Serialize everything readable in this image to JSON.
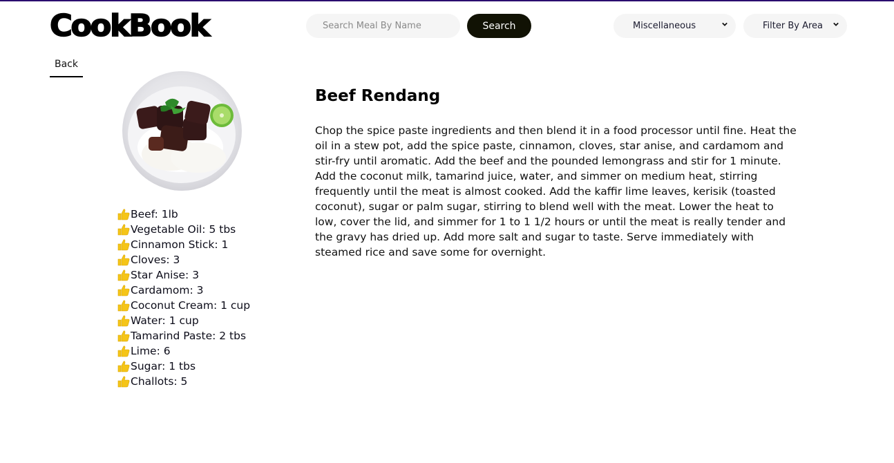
{
  "header": {
    "logo": "CookBook",
    "search": {
      "placeholder": "Search Meal By Name",
      "value": "",
      "button_label": "Search"
    },
    "category_select": {
      "selected": "Miscellaneous",
      "icon": "chevron-down-icon"
    },
    "area_select": {
      "selected": "Filter By Area",
      "icon": "chevron-down-icon"
    }
  },
  "nav": {
    "back_label": "Back"
  },
  "meal": {
    "title": "Beef Rendang",
    "image_alt": "Beef Rendang with rice and lime",
    "bullet_icon": "thumbs-up-icon",
    "ingredients": [
      "Beef: 1lb",
      "Vegetable Oil: 5 tbs",
      "Cinnamon Stick: 1",
      "Cloves: 3",
      "Star Anise: 3",
      "Cardamom: 3",
      "Coconut Cream: 1 cup",
      "Water: 1 cup",
      "Tamarind Paste: 2 tbs",
      "Lime: 6",
      "Sugar: 1 tbs",
      "Challots: 5"
    ],
    "instructions": "Chop the spice paste ingredients and then blend it in a food processor until fine. Heat the oil in a stew pot, add the spice paste, cinnamon, cloves, star anise, and cardamom and stir-fry until aromatic. Add the beef and the pounded lemongrass and stir for 1 minute. Add the coconut milk, tamarind juice, water, and simmer on medium heat, stirring frequently until the meat is almost cooked. Add the kaffir lime leaves, kerisik (toasted coconut), sugar or palm sugar, stirring to blend well with the meat. Lower the heat to low, cover the lid, and simmer for 1 to 1 1/2 hours or until the meat is really tender and the gravy has dried up. Add more salt and sugar to taste. Serve immediately with steamed rice and save some for overnight."
  },
  "colors": {
    "top_border": "#2a0a6e",
    "search_button_bg": "#111204",
    "input_bg": "#f5f5f5",
    "thumb_icon": "#f5c518"
  }
}
